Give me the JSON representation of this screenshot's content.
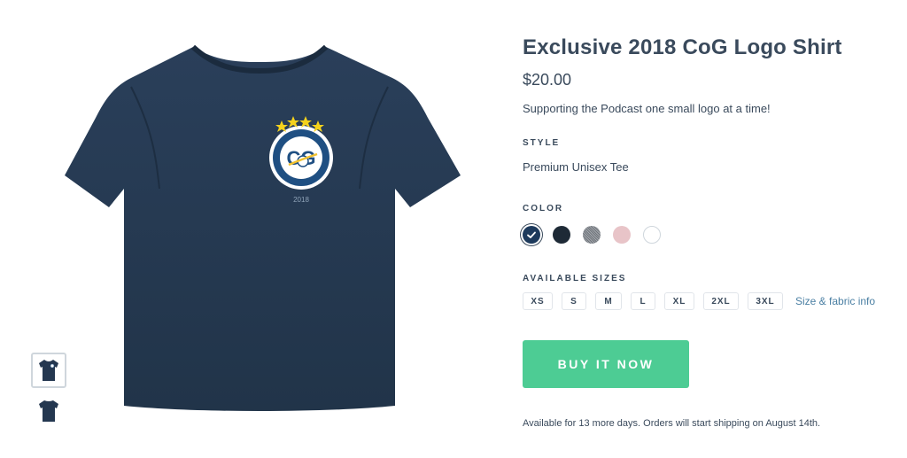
{
  "product": {
    "title": "Exclusive 2018 CoG Logo Shirt",
    "price": "$20.00",
    "description": "Supporting the Podcast one small logo at a time!"
  },
  "style": {
    "label": "STYLE",
    "value": "Premium Unisex Tee"
  },
  "color": {
    "label": "COLOR",
    "swatches": [
      {
        "name": "navy",
        "hex": "#1d3a5c",
        "selected": true
      },
      {
        "name": "black",
        "hex": "#1e2a36",
        "selected": false
      },
      {
        "name": "heather grey",
        "hex": "#8a8e94",
        "selected": false
      },
      {
        "name": "pink",
        "hex": "#e8c4c8",
        "selected": false
      },
      {
        "name": "white",
        "hex": "#ffffff",
        "selected": false
      }
    ]
  },
  "sizes": {
    "label": "AVAILABLE SIZES",
    "options": [
      "XS",
      "S",
      "M",
      "L",
      "XL",
      "2XL",
      "3XL"
    ],
    "info_link": "Size & fabric info"
  },
  "buy_button": "BUY IT NOW",
  "availability": "Available for 13 more days. Orders will start shipping on August 14th.",
  "shirt_color": "#243750",
  "accent_color": "#4dcc94"
}
